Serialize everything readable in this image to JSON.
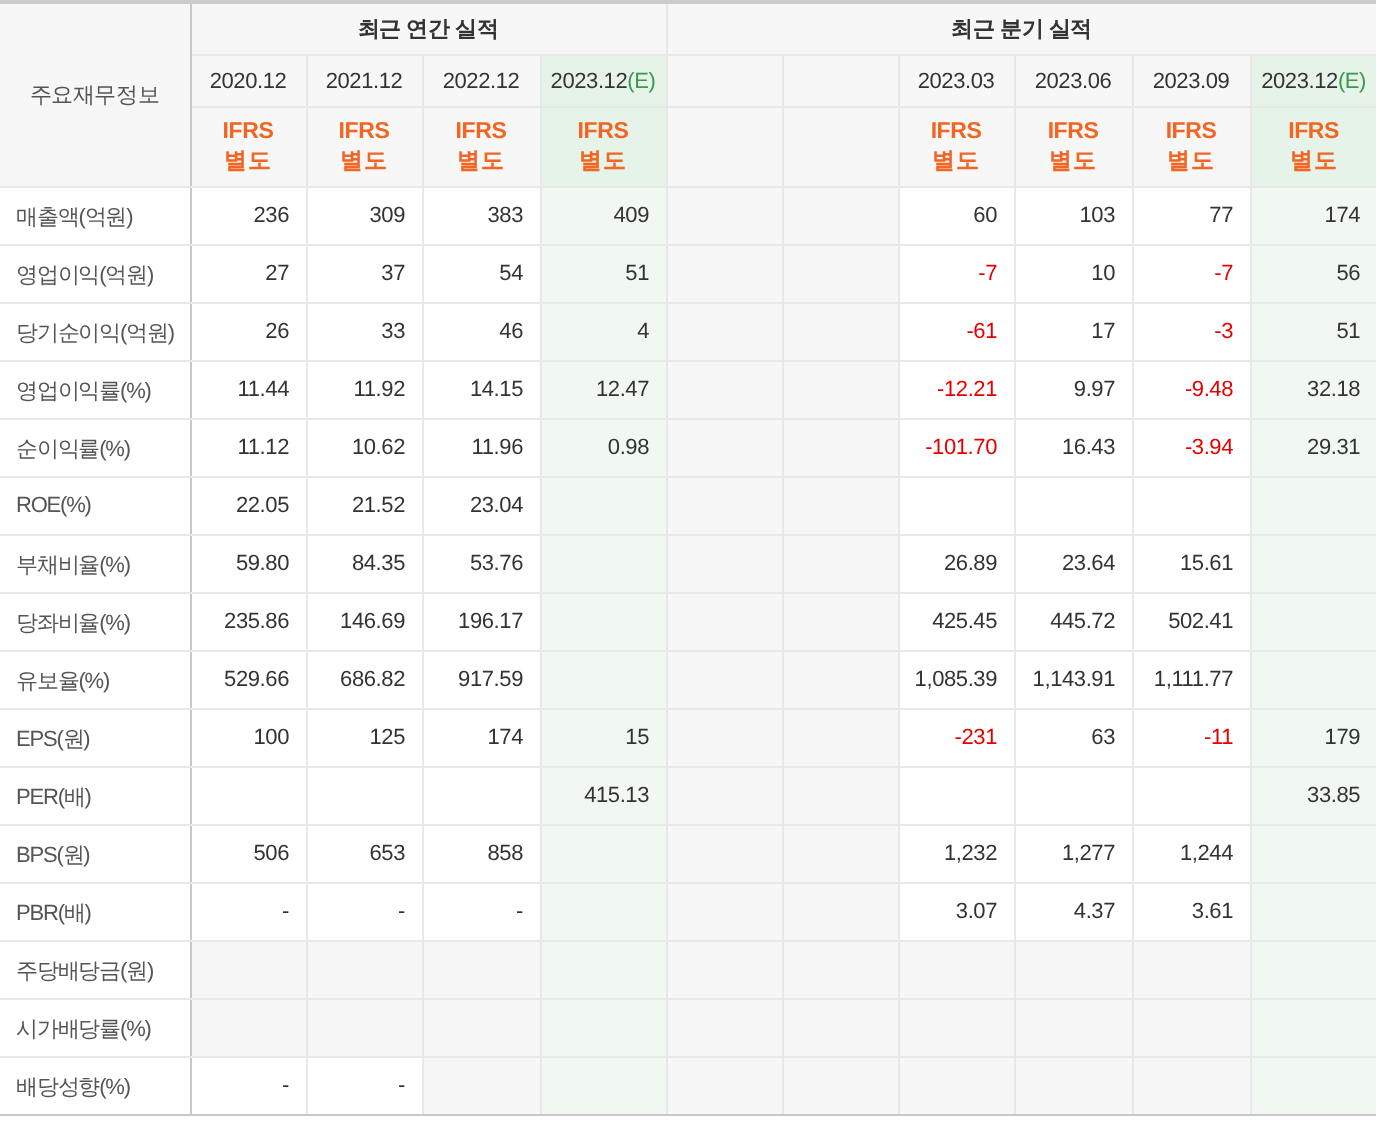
{
  "table": {
    "corner_label": "주요재무정보",
    "sections": [
      {
        "title": "최근 연간 실적",
        "columns": [
          {
            "kind": "period",
            "period": "2020.12",
            "accounting": "IFRS 별도",
            "estimate": false
          },
          {
            "kind": "period",
            "period": "2021.12",
            "accounting": "IFRS 별도",
            "estimate": false
          },
          {
            "kind": "period",
            "period": "2022.12",
            "accounting": "IFRS 별도",
            "estimate": false
          },
          {
            "kind": "period",
            "period": "2023.12",
            "estimate_mark": "(E)",
            "accounting": "IFRS 별도",
            "estimate": true
          }
        ]
      },
      {
        "title": "최근 분기 실적",
        "columns": [
          {
            "kind": "empty"
          },
          {
            "kind": "empty"
          },
          {
            "kind": "period",
            "period": "2023.03",
            "accounting": "IFRS 별도",
            "estimate": false
          },
          {
            "kind": "period",
            "period": "2023.06",
            "accounting": "IFRS 별도",
            "estimate": false
          },
          {
            "kind": "period",
            "period": "2023.09",
            "accounting": "IFRS 별도",
            "estimate": false
          },
          {
            "kind": "period",
            "period": "2023.12",
            "estimate_mark": "(E)",
            "accounting": "IFRS 별도",
            "estimate": true
          }
        ]
      }
    ],
    "groups": [
      {
        "rows": [
          {
            "label": "매출액(억원)",
            "cells": [
              {
                "kind": "value",
                "text": "236",
                "negative": false
              },
              {
                "kind": "value",
                "text": "309",
                "negative": false
              },
              {
                "kind": "value",
                "text": "383",
                "negative": false
              },
              {
                "kind": "value",
                "text": "409",
                "negative": false
              },
              {
                "kind": "na"
              },
              {
                "kind": "na"
              },
              {
                "kind": "value",
                "text": "60",
                "negative": false
              },
              {
                "kind": "value",
                "text": "103",
                "negative": false
              },
              {
                "kind": "value",
                "text": "77",
                "negative": false
              },
              {
                "kind": "value",
                "text": "174",
                "negative": false
              }
            ]
          },
          {
            "label": "영업이익(억원)",
            "cells": [
              {
                "kind": "value",
                "text": "27",
                "negative": false
              },
              {
                "kind": "value",
                "text": "37",
                "negative": false
              },
              {
                "kind": "value",
                "text": "54",
                "negative": false
              },
              {
                "kind": "value",
                "text": "51",
                "negative": false
              },
              {
                "kind": "na"
              },
              {
                "kind": "na"
              },
              {
                "kind": "value",
                "text": "-7",
                "negative": true
              },
              {
                "kind": "value",
                "text": "10",
                "negative": false
              },
              {
                "kind": "value",
                "text": "-7",
                "negative": true
              },
              {
                "kind": "value",
                "text": "56",
                "negative": false
              }
            ]
          },
          {
            "label": "당기순이익(억원)",
            "cells": [
              {
                "kind": "value",
                "text": "26",
                "negative": false
              },
              {
                "kind": "value",
                "text": "33",
                "negative": false
              },
              {
                "kind": "value",
                "text": "46",
                "negative": false
              },
              {
                "kind": "value",
                "text": "4",
                "negative": false
              },
              {
                "kind": "na"
              },
              {
                "kind": "na"
              },
              {
                "kind": "value",
                "text": "-61",
                "negative": true
              },
              {
                "kind": "value",
                "text": "17",
                "negative": false
              },
              {
                "kind": "value",
                "text": "-3",
                "negative": true
              },
              {
                "kind": "value",
                "text": "51",
                "negative": false
              }
            ]
          }
        ]
      },
      {
        "rows": [
          {
            "label": "영업이익률(%)",
            "cells": [
              {
                "kind": "value",
                "text": "11.44",
                "negative": false
              },
              {
                "kind": "value",
                "text": "11.92",
                "negative": false
              },
              {
                "kind": "value",
                "text": "14.15",
                "negative": false
              },
              {
                "kind": "value",
                "text": "12.47",
                "negative": false
              },
              {
                "kind": "na"
              },
              {
                "kind": "na"
              },
              {
                "kind": "value",
                "text": "-12.21",
                "negative": true
              },
              {
                "kind": "value",
                "text": "9.97",
                "negative": false
              },
              {
                "kind": "value",
                "text": "-9.48",
                "negative": true
              },
              {
                "kind": "value",
                "text": "32.18",
                "negative": false
              }
            ]
          },
          {
            "label": "순이익률(%)",
            "cells": [
              {
                "kind": "value",
                "text": "11.12",
                "negative": false
              },
              {
                "kind": "value",
                "text": "10.62",
                "negative": false
              },
              {
                "kind": "value",
                "text": "11.96",
                "negative": false
              },
              {
                "kind": "value",
                "text": "0.98",
                "negative": false
              },
              {
                "kind": "na"
              },
              {
                "kind": "na"
              },
              {
                "kind": "value",
                "text": "-101.70",
                "negative": true
              },
              {
                "kind": "value",
                "text": "16.43",
                "negative": false
              },
              {
                "kind": "value",
                "text": "-3.94",
                "negative": true
              },
              {
                "kind": "value",
                "text": "29.31",
                "negative": false
              }
            ]
          },
          {
            "label": "ROE(%)",
            "cells": [
              {
                "kind": "value",
                "text": "22.05",
                "negative": false
              },
              {
                "kind": "value",
                "text": "21.52",
                "negative": false
              },
              {
                "kind": "value",
                "text": "23.04",
                "negative": false
              },
              {
                "kind": "blank"
              },
              {
                "kind": "na"
              },
              {
                "kind": "na"
              },
              {
                "kind": "blank"
              },
              {
                "kind": "blank"
              },
              {
                "kind": "blank"
              },
              {
                "kind": "blank"
              }
            ]
          }
        ]
      },
      {
        "rows": [
          {
            "label": "부채비율(%)",
            "cells": [
              {
                "kind": "value",
                "text": "59.80",
                "negative": false
              },
              {
                "kind": "value",
                "text": "84.35",
                "negative": false
              },
              {
                "kind": "value",
                "text": "53.76",
                "negative": false
              },
              {
                "kind": "blank"
              },
              {
                "kind": "na"
              },
              {
                "kind": "na"
              },
              {
                "kind": "value",
                "text": "26.89",
                "negative": false
              },
              {
                "kind": "value",
                "text": "23.64",
                "negative": false
              },
              {
                "kind": "value",
                "text": "15.61",
                "negative": false
              },
              {
                "kind": "blank"
              }
            ]
          },
          {
            "label": "당좌비율(%)",
            "cells": [
              {
                "kind": "value",
                "text": "235.86",
                "negative": false
              },
              {
                "kind": "value",
                "text": "146.69",
                "negative": false
              },
              {
                "kind": "value",
                "text": "196.17",
                "negative": false
              },
              {
                "kind": "blank"
              },
              {
                "kind": "na"
              },
              {
                "kind": "na"
              },
              {
                "kind": "value",
                "text": "425.45",
                "negative": false
              },
              {
                "kind": "value",
                "text": "445.72",
                "negative": false
              },
              {
                "kind": "value",
                "text": "502.41",
                "negative": false
              },
              {
                "kind": "blank"
              }
            ]
          },
          {
            "label": "유보율(%)",
            "cells": [
              {
                "kind": "value",
                "text": "529.66",
                "negative": false
              },
              {
                "kind": "value",
                "text": "686.82",
                "negative": false
              },
              {
                "kind": "value",
                "text": "917.59",
                "negative": false
              },
              {
                "kind": "blank"
              },
              {
                "kind": "na"
              },
              {
                "kind": "na"
              },
              {
                "kind": "value",
                "text": "1,085.39",
                "negative": false
              },
              {
                "kind": "value",
                "text": "1,143.91",
                "negative": false
              },
              {
                "kind": "value",
                "text": "1,111.77",
                "negative": false
              },
              {
                "kind": "blank"
              }
            ]
          }
        ]
      },
      {
        "rows": [
          {
            "label": "EPS(원)",
            "cells": [
              {
                "kind": "value",
                "text": "100",
                "negative": false
              },
              {
                "kind": "value",
                "text": "125",
                "negative": false
              },
              {
                "kind": "value",
                "text": "174",
                "negative": false
              },
              {
                "kind": "value",
                "text": "15",
                "negative": false
              },
              {
                "kind": "na"
              },
              {
                "kind": "na"
              },
              {
                "kind": "value",
                "text": "-231",
                "negative": true
              },
              {
                "kind": "value",
                "text": "63",
                "negative": false
              },
              {
                "kind": "value",
                "text": "-11",
                "negative": true
              },
              {
                "kind": "value",
                "text": "179",
                "negative": false
              }
            ]
          },
          {
            "label": "PER(배)",
            "cells": [
              {
                "kind": "blank"
              },
              {
                "kind": "blank"
              },
              {
                "kind": "blank"
              },
              {
                "kind": "value",
                "text": "415.13",
                "negative": false
              },
              {
                "kind": "na"
              },
              {
                "kind": "na"
              },
              {
                "kind": "blank"
              },
              {
                "kind": "blank"
              },
              {
                "kind": "blank"
              },
              {
                "kind": "value",
                "text": "33.85",
                "negative": false
              }
            ]
          },
          {
            "label": "BPS(원)",
            "cells": [
              {
                "kind": "value",
                "text": "506",
                "negative": false
              },
              {
                "kind": "value",
                "text": "653",
                "negative": false
              },
              {
                "kind": "value",
                "text": "858",
                "negative": false
              },
              {
                "kind": "blank"
              },
              {
                "kind": "na"
              },
              {
                "kind": "na"
              },
              {
                "kind": "value",
                "text": "1,232",
                "negative": false
              },
              {
                "kind": "value",
                "text": "1,277",
                "negative": false
              },
              {
                "kind": "value",
                "text": "1,244",
                "negative": false
              },
              {
                "kind": "blank"
              }
            ]
          },
          {
            "label": "PBR(배)",
            "cells": [
              {
                "kind": "value",
                "text": "-",
                "negative": false
              },
              {
                "kind": "value",
                "text": "-",
                "negative": false
              },
              {
                "kind": "value",
                "text": "-",
                "negative": false
              },
              {
                "kind": "blank"
              },
              {
                "kind": "na"
              },
              {
                "kind": "na"
              },
              {
                "kind": "value",
                "text": "3.07",
                "negative": false
              },
              {
                "kind": "value",
                "text": "4.37",
                "negative": false
              },
              {
                "kind": "value",
                "text": "3.61",
                "negative": false
              },
              {
                "kind": "blank"
              }
            ]
          }
        ]
      },
      {
        "rows": [
          {
            "label": "주당배당금(원)",
            "cells": [
              {
                "kind": "na"
              },
              {
                "kind": "na"
              },
              {
                "kind": "na"
              },
              {
                "kind": "blank"
              },
              {
                "kind": "na"
              },
              {
                "kind": "na"
              },
              {
                "kind": "na"
              },
              {
                "kind": "na"
              },
              {
                "kind": "na"
              },
              {
                "kind": "blank"
              }
            ]
          },
          {
            "label": "시가배당률(%)",
            "cells": [
              {
                "kind": "na"
              },
              {
                "kind": "na"
              },
              {
                "kind": "na"
              },
              {
                "kind": "blank"
              },
              {
                "kind": "na"
              },
              {
                "kind": "na"
              },
              {
                "kind": "na"
              },
              {
                "kind": "na"
              },
              {
                "kind": "na"
              },
              {
                "kind": "blank"
              }
            ]
          },
          {
            "label": "배당성향(%)",
            "cells": [
              {
                "kind": "value",
                "text": "-",
                "negative": false
              },
              {
                "kind": "value",
                "text": "-",
                "negative": false
              },
              {
                "kind": "na"
              },
              {
                "kind": "blank"
              },
              {
                "kind": "na"
              },
              {
                "kind": "na"
              },
              {
                "kind": "na"
              },
              {
                "kind": "na"
              },
              {
                "kind": "na"
              },
              {
                "kind": "blank"
              }
            ]
          }
        ]
      }
    ]
  }
}
